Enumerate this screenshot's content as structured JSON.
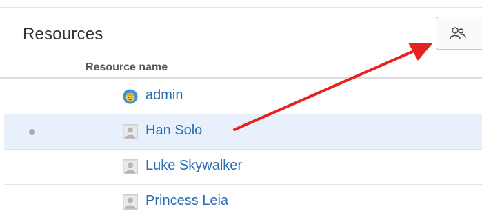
{
  "panel": {
    "title": "Resources"
  },
  "toolbar": {
    "button_icon": "user-group-icon"
  },
  "table": {
    "column_header": "Resource name",
    "rows": [
      {
        "name": "admin",
        "avatar": "admin-avatar-icon",
        "selected": false
      },
      {
        "name": "Han Solo",
        "avatar": "user-placeholder-icon",
        "selected": true
      },
      {
        "name": "Luke Skywalker",
        "avatar": "user-placeholder-icon",
        "selected": false
      },
      {
        "name": "Princess Leia",
        "avatar": "user-placeholder-icon",
        "selected": false
      }
    ]
  },
  "colors": {
    "link": "#2a6db7",
    "selected_row": "#e8f0fb",
    "annotation_arrow": "#e8231f"
  }
}
